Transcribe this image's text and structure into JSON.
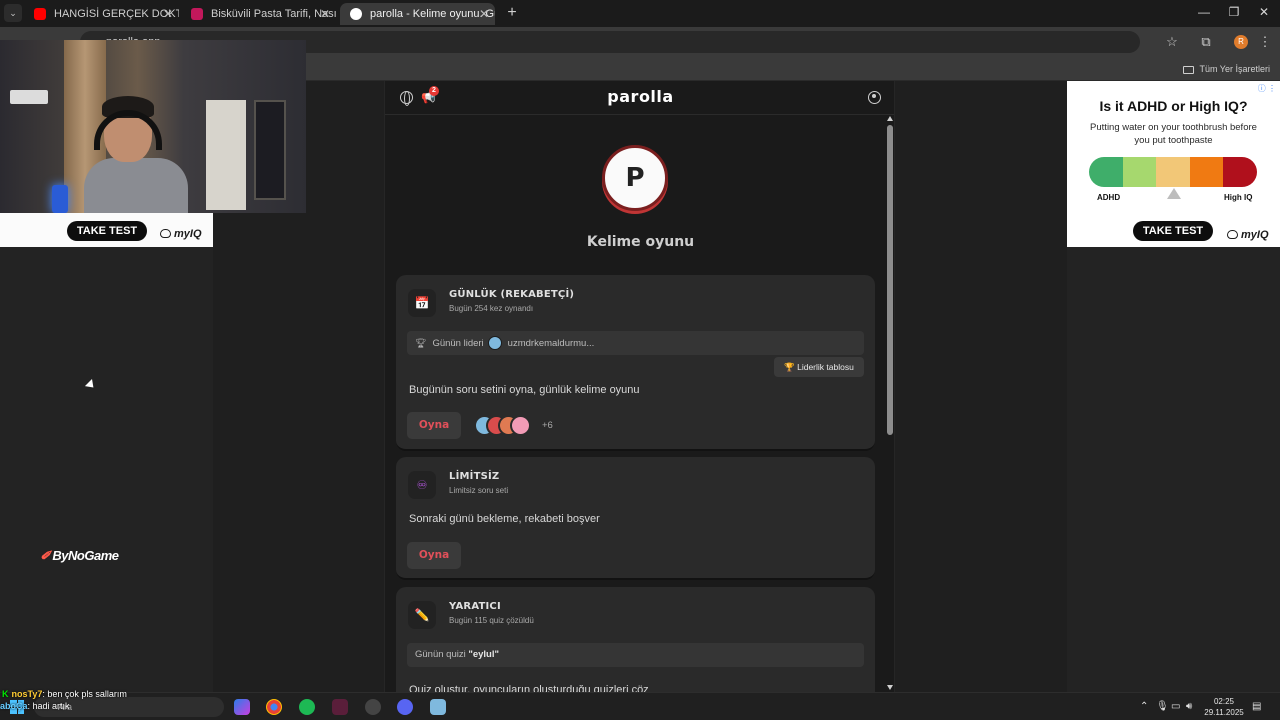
{
  "browser": {
    "tabs": [
      {
        "title": "HANGİSİ GERÇEK DOKTOR?! ft.",
        "favicon_color": "#ff0000",
        "active": false
      },
      {
        "title": "Bisküvili Pasta Tarifi, Nasıl Yapılır",
        "favicon_color": "#c2185b",
        "active": false
      },
      {
        "title": "parolla - Kelime oyunu. Günlük",
        "favicon_color": "#ffffff",
        "active": true
      }
    ],
    "new_tab": "+",
    "url": "parolla.app",
    "bookmarks_all": "Tüm Yer İşaretleri",
    "profile_initial": "R",
    "window_controls": [
      "—",
      "❐",
      "✕"
    ]
  },
  "left_ad": {
    "button": "TAKE TEST",
    "brand": "myIQ"
  },
  "sidebar_logo": "ByNoGame",
  "right_ad": {
    "title": "Is it ADHD or High IQ?",
    "subtitle": "Putting water on your toothbrush before you put toothpaste",
    "scale_colors": [
      "#3fae6a",
      "#a6d86e",
      "#f2c777",
      "#f07a12",
      "#b0101c"
    ],
    "label_left": "ADHD",
    "label_right": "High IQ",
    "button": "TAKE TEST",
    "brand": "myIQ",
    "adchoice": "ⓘ ⋮"
  },
  "app": {
    "brand": "parolla",
    "notif_count": "2",
    "logo_letter": "P",
    "title": "Kelime oyunu",
    "accent": "#e2505a",
    "cards": {
      "daily": {
        "title": "GÜNLÜK (REKABETÇİ)",
        "sub": "Bugün 254 kez oynandı",
        "leader_label": "Günün lideri",
        "leader_name": "uzmdrkemaldurmu...",
        "leaderboard_button": "🏆 Liderlik tablosu",
        "desc": "Bugünün soru setini oyna, günlük kelime oyunu",
        "play": "Oyna",
        "more_players": "+6",
        "player_colors": [
          "#7fb9de",
          "#d94c4c",
          "#e07a52",
          "#f29bb6"
        ]
      },
      "unlimited": {
        "title": "LİMİTSİZ",
        "sub": "Limitsiz soru seti",
        "desc": "Sonraki günü bekleme, rekabeti boşver",
        "play": "Oyna"
      },
      "creator": {
        "title": "YARATICI",
        "sub": "Bugün 115 quiz çözüldü",
        "quiz_label": "Günün quizi ",
        "quiz_name": "\"eylul\"",
        "desc": "Quiz oluştur, oyuncuların oluşturduğu quizleri çöz"
      }
    }
  },
  "chat": [
    {
      "user": "nosTy7",
      "text": ": ben çok pls sallarım"
    },
    {
      "user": "aboÇa",
      "text": ": hadi artık"
    }
  ],
  "taskbar": {
    "search_placeholder": "Ara",
    "time": "02:25",
    "date": "29.11.2025"
  }
}
